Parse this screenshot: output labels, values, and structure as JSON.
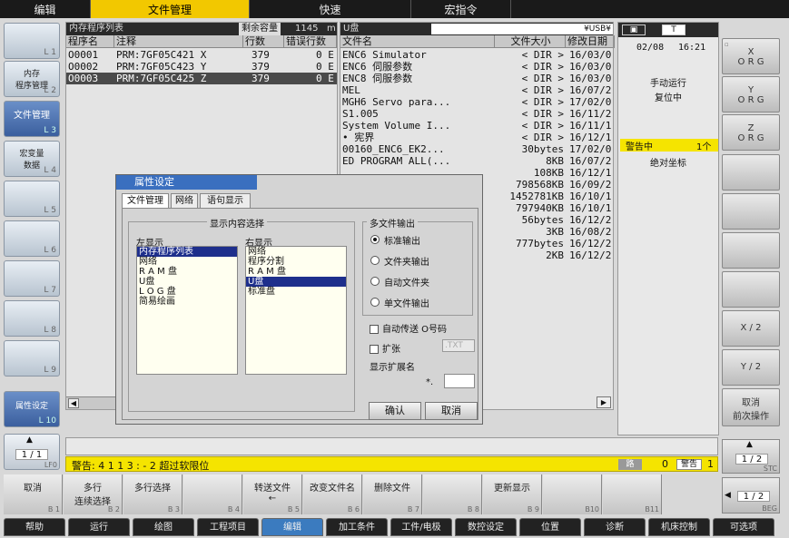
{
  "top_menu": [
    "编辑",
    "文件管理",
    "快速",
    "宏指令"
  ],
  "left_keys": [
    {
      "label": "",
      "key": "L 1"
    },
    {
      "label": "内存\n程序管理",
      "key": "L 2"
    },
    {
      "label": "文件管理",
      "key": "L 3"
    },
    {
      "label": "宏变量\n数据",
      "key": "L 4"
    },
    {
      "label": "",
      "key": "L 5"
    },
    {
      "label": "",
      "key": "L 6"
    },
    {
      "label": "",
      "key": "L 7"
    },
    {
      "label": "",
      "key": "L 8"
    },
    {
      "label": "",
      "key": "L 9"
    },
    {
      "label": "属性设定",
      "key": "L 10"
    }
  ],
  "memory_panel": {
    "title": "内存程序列表",
    "remaining_label": "剩余容量",
    "remaining_value": "1145",
    "remaining_unit": "m",
    "columns": [
      "程序名",
      "注释",
      "行数",
      "错误行数"
    ],
    "rows": [
      {
        "name": "O0001",
        "comment": "PRM:7GF05C421 X",
        "lines": "379",
        "errors": "0 E"
      },
      {
        "name": "O0002",
        "comment": "PRM:7GF05C423 Y",
        "lines": "379",
        "errors": "0 E"
      },
      {
        "name": "O0003",
        "comment": "PRM:7GF05C425 Z",
        "lines": "379",
        "errors": "0 E"
      }
    ]
  },
  "usb_panel": {
    "title": "U盘",
    "path": "¥USB¥",
    "columns": [
      "文件名",
      "文件大小",
      "修改日期"
    ],
    "rows": [
      {
        "name": "ENC6 Simulator",
        "size": "< DIR >",
        "date": "16/03/0"
      },
      {
        "name": "ENC6 伺服参数",
        "size": "< DIR >",
        "date": "16/03/0"
      },
      {
        "name": "ENC8 伺服参数",
        "size": "< DIR >",
        "date": "16/03/0"
      },
      {
        "name": "MEL",
        "size": "< DIR >",
        "date": "16/07/2"
      },
      {
        "name": "MGH6 Servo para...",
        "size": "< DIR >",
        "date": "17/02/0"
      },
      {
        "name": "S1.005",
        "size": "< DIR >",
        "date": "16/11/2"
      },
      {
        "name": "System Volume I...",
        "size": "< DIR >",
        "date": "16/11/1"
      },
      {
        "name": "• 宪界",
        "size": "< DIR >",
        "date": "16/12/1"
      },
      {
        "name": "00160_ENC6_EK2...",
        "size": "30bytes",
        "date": "17/02/0"
      },
      {
        "name": "ED PROGRAM ALL(...",
        "size": "8KB",
        "date": "16/07/2"
      },
      {
        "name": "",
        "size": "108KB",
        "date": "16/12/1"
      },
      {
        "name": "",
        "size": "798568KB",
        "date": "16/09/2"
      },
      {
        "name": "",
        "size": "1452781KB",
        "date": "16/10/1"
      },
      {
        "name": "",
        "size": "797940KB",
        "date": "16/10/1"
      },
      {
        "name": "",
        "size": "56bytes",
        "date": "16/12/2"
      },
      {
        "name": "",
        "size": "3KB",
        "date": "16/08/2"
      },
      {
        "name": "",
        "size": "777bytes",
        "date": "16/12/2"
      },
      {
        "name": "",
        "size": "2KB",
        "date": "16/12/2"
      }
    ]
  },
  "dialog": {
    "title": "属性设定",
    "tabs": [
      "文件管理",
      "网络",
      "语句显示"
    ],
    "display_group": "显示内容选择",
    "left_label": "左显示",
    "left_items": [
      "内存程序列表",
      "网络",
      "R A M 盘",
      "U盘",
      "L O G 盘",
      "简易绘画"
    ],
    "left_selected": 0,
    "right_label": "右显示",
    "right_items": [
      "网络",
      "程序分割",
      "R A M 盘",
      "U盘",
      "标准盘"
    ],
    "right_selected": 3,
    "multi_group": "多文件输出",
    "radios": [
      "标准输出",
      "文件夹输出",
      "自动文件夹",
      "单文件输出"
    ],
    "radio_selected": 0,
    "auto_send": "自动传送 O号码",
    "ext_label": "扩张",
    "ext_value": ".TXT",
    "show_ext_label": "显示扩展名",
    "show_ext_prefix": "*.",
    "ok": "确认",
    "cancel": "取消"
  },
  "status_panel": {
    "date": "02/08",
    "time": "16:21",
    "mode": "手动运行",
    "state": "复位中",
    "alarm": "警告中",
    "alarm_count": "1个",
    "coord": "绝对坐标"
  },
  "right_keys": [
    {
      "top": "X",
      "bottom": "O R G"
    },
    {
      "top": "Y",
      "bottom": "O R G"
    },
    {
      "top": "Z",
      "bottom": "O R G"
    },
    {
      "top": "",
      "bottom": ""
    },
    {
      "top": "",
      "bottom": ""
    },
    {
      "top": "",
      "bottom": ""
    },
    {
      "top": "",
      "bottom": ""
    },
    {
      "top": "X / 2",
      "bottom": ""
    },
    {
      "top": "Y / 2",
      "bottom": ""
    },
    {
      "top": "取消\n前次操作",
      "bottom": ""
    }
  ],
  "page_left": "1 / 1",
  "page_left_label": "LF0",
  "page_right": "1 / 2",
  "page_right_label": "STC",
  "page_right2": "1 / 2",
  "page_right2_label": "BEG",
  "alarm_bar": {
    "text": "警告: 4 1 1 3 : - 2  超过软限位",
    "right1": "路",
    "right2": "0",
    "right3": "警告",
    "right4": "1"
  },
  "soft_keys": [
    {
      "label": "取消",
      "key": "B 1"
    },
    {
      "label": "多行\n连续选择",
      "key": "B 2"
    },
    {
      "label": "多行选择",
      "key": "B 3"
    },
    {
      "label": "",
      "key": "B 4"
    },
    {
      "label": "转送文件\n←",
      "key": "B 5"
    },
    {
      "label": "改变文件名",
      "key": "B 6"
    },
    {
      "label": "删除文件",
      "key": "B 7"
    },
    {
      "label": "",
      "key": "B 8"
    },
    {
      "label": "更新显示",
      "key": "B 9"
    },
    {
      "label": "",
      "key": "B10"
    },
    {
      "label": "",
      "key": "B11"
    }
  ],
  "main_tabs": [
    "帮助",
    "运行",
    "绘图",
    "工程项目",
    "编辑",
    "加工条件",
    "工件/电极",
    "数控设定",
    "位置",
    "诊断",
    "机床控制",
    "可选项"
  ],
  "main_tab_selected": 4
}
